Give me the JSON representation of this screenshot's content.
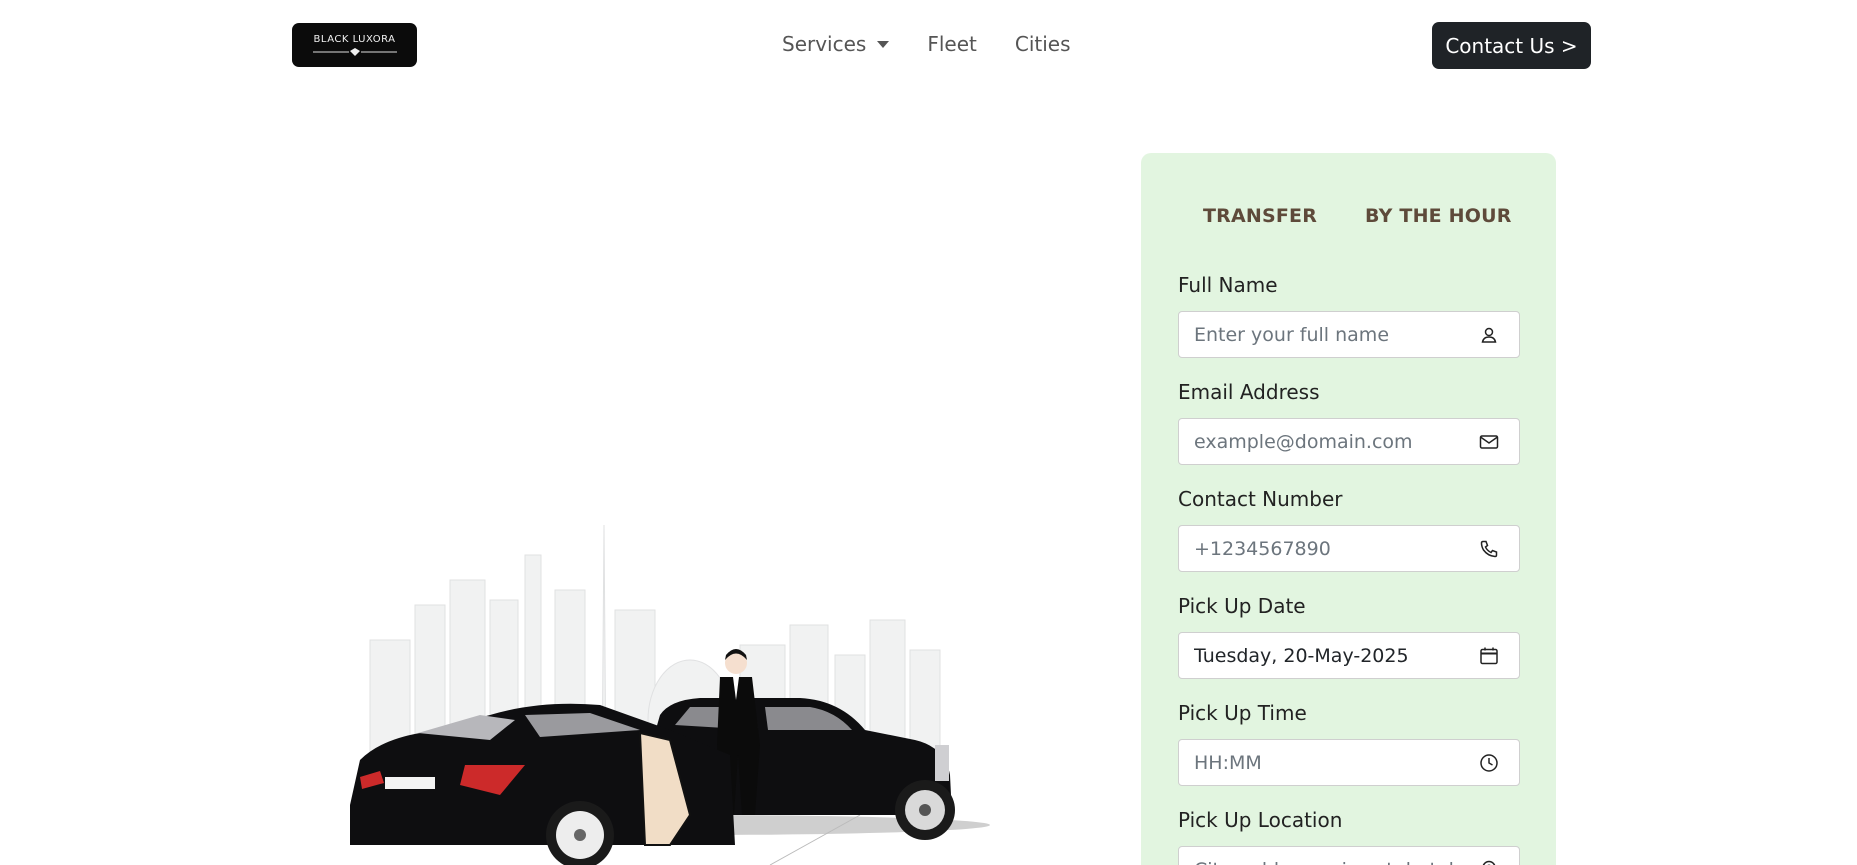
{
  "nav": {
    "logo_text": "BLACK LUXORA",
    "links": [
      "Services",
      "Fleet",
      "Cities"
    ],
    "contact_label": "Contact Us >"
  },
  "booking": {
    "tabs": [
      "TRANSFER",
      "BY THE HOUR"
    ],
    "fields": [
      {
        "label": "Full Name",
        "placeholder": "Enter your full name",
        "value": "",
        "icon": "person-icon"
      },
      {
        "label": "Email Address",
        "placeholder": "example@domain.com",
        "value": "",
        "icon": "envelope-icon"
      },
      {
        "label": "Contact Number",
        "placeholder": "+1234567890",
        "value": "",
        "icon": "phone-icon"
      },
      {
        "label": "Pick Up Date",
        "placeholder": "",
        "value": "Tuesday, 20-May-2025",
        "icon": "calendar-icon"
      },
      {
        "label": "Pick Up Time",
        "placeholder": "HH:MM",
        "value": "",
        "icon": "clock-icon"
      },
      {
        "label": "Pick Up Location",
        "placeholder": "City, address, airport, hotel",
        "value": "",
        "icon": "location-icon"
      }
    ]
  },
  "colors": {
    "card_background": "#e2f5e0",
    "tab_text": "#5e4a3a",
    "button_background": "#1f2327"
  }
}
